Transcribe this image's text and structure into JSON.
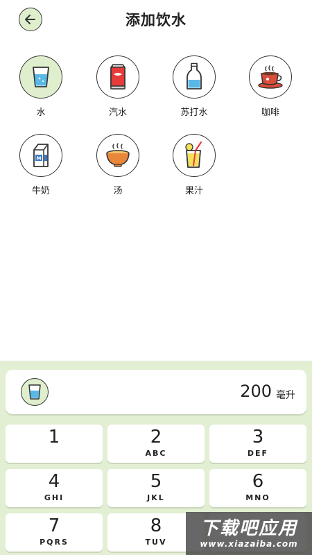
{
  "header": {
    "title": "添加饮水"
  },
  "drinks": [
    {
      "label": "水",
      "icon": "water-glass-icon",
      "selected": true
    },
    {
      "label": "汽水",
      "icon": "soda-can-icon",
      "selected": false
    },
    {
      "label": "苏打水",
      "icon": "soda-water-bottle-icon",
      "selected": false
    },
    {
      "label": "咖啡",
      "icon": "coffee-cup-icon",
      "selected": false
    },
    {
      "label": "牛奶",
      "icon": "milk-carton-icon",
      "selected": false
    },
    {
      "label": "汤",
      "icon": "soup-bowl-icon",
      "selected": false
    },
    {
      "label": "果汁",
      "icon": "juice-glass-icon",
      "selected": false
    }
  ],
  "amount": {
    "value": "200",
    "unit": "毫升"
  },
  "keypad": [
    {
      "num": "1",
      "letters": ""
    },
    {
      "num": "2",
      "letters": "ABC"
    },
    {
      "num": "3",
      "letters": "DEF"
    },
    {
      "num": "4",
      "letters": "GHI"
    },
    {
      "num": "5",
      "letters": "JKL"
    },
    {
      "num": "6",
      "letters": "MNO"
    },
    {
      "num": "7",
      "letters": "PQRS"
    },
    {
      "num": "8",
      "letters": "TUV"
    }
  ],
  "watermark": {
    "title": "下载吧应用",
    "url": "www.xiazaiba.com"
  },
  "colors": {
    "accent_green": "#dfeecd",
    "panel_bg": "#e2efd3",
    "water_blue": "#5ab8e6"
  }
}
